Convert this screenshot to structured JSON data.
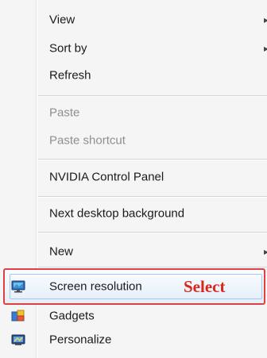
{
  "context_menu": {
    "items": [
      {
        "label": "View",
        "has_submenu": true
      },
      {
        "label": "Sort by",
        "has_submenu": true
      },
      {
        "label": "Refresh"
      },
      {
        "label": "Paste",
        "disabled": true
      },
      {
        "label": "Paste shortcut",
        "disabled": true
      },
      {
        "label": "NVIDIA Control Panel"
      },
      {
        "label": "Next desktop background"
      },
      {
        "label": "New",
        "has_submenu": true
      },
      {
        "label": "Screen resolution",
        "icon": "monitor-icon",
        "highlighted": true
      },
      {
        "label": "Gadgets",
        "icon": "gadgets-icon"
      },
      {
        "label": "Personalize",
        "icon": "personalize-icon"
      }
    ],
    "submenu_arrow": "▸"
  },
  "annotation": {
    "text": "Select",
    "color": "#d9261c"
  },
  "colors": {
    "highlight_border": "#e04040",
    "menu_bg": "#f5f5f5",
    "disabled_text": "#8f8f8f"
  }
}
